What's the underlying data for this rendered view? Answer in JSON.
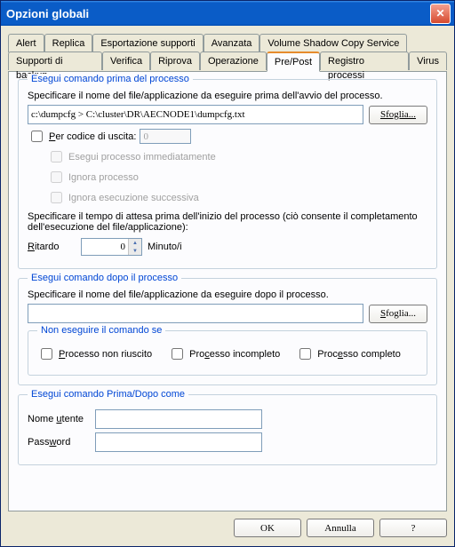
{
  "title": "Opzioni globali",
  "tabs_row1": [
    "Alert",
    "Replica",
    "Esportazione supporti",
    "Avanzata",
    "Volume Shadow Copy Service"
  ],
  "tabs_row2": [
    "Supporti di backup",
    "Verifica",
    "Riprova",
    "Operazione",
    "Pre/Post",
    "Registro processi",
    "Virus"
  ],
  "active_tab": "Pre/Post",
  "gb1": {
    "legend": "Esegui comando prima del processo",
    "desc": "Specificare il nome del file/applicazione da eseguire prima dell'avvio del processo.",
    "path": "c:\\dumpcfg > C:\\cluster\\DR\\AECNODE1\\dumpcfg.txt",
    "browse": "Sfoglia...",
    "exit_label": "Per codice di uscita:",
    "exit_value": "0",
    "opt1": "Esegui processo immediatamente",
    "opt2": "Ignora processo",
    "opt3": "Ignora esecuzione successiva",
    "delay_desc": "Specificare il tempo di attesa prima dell'inizio del processo (ciò consente il completamento dell'esecuzione del file/applicazione):",
    "delay_label": "Ritardo",
    "delay_value": "0",
    "delay_unit": "Minuto/i"
  },
  "gb2": {
    "legend": "Esegui comando dopo il processo",
    "desc": "Specificare il nome del file/applicazione da eseguire dopo il processo.",
    "path": "",
    "browse": "Sfoglia...",
    "sub_legend": "Non eseguire il comando se",
    "chk1": "Processo non riuscito",
    "chk2": "Processo incompleto",
    "chk3": "Processo completo"
  },
  "gb3": {
    "legend": "Esegui comando Prima/Dopo come",
    "user_label": "Nome utente",
    "user_value": "",
    "pass_label": "Password",
    "pass_value": ""
  },
  "buttons": {
    "ok": "OK",
    "cancel": "Annulla",
    "help": "?"
  }
}
